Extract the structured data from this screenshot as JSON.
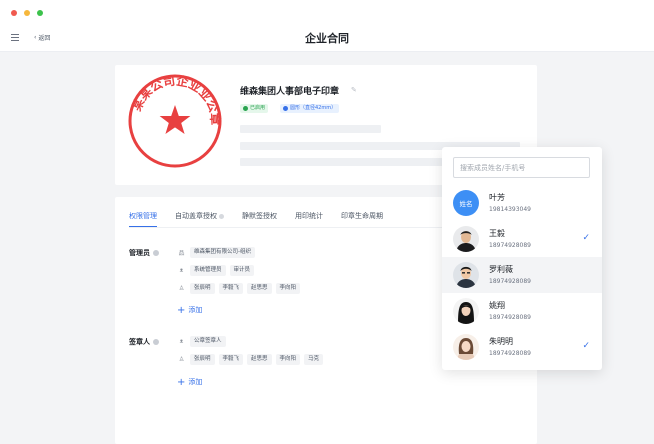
{
  "header": {
    "title": "企业合同",
    "back_label": "返回"
  },
  "seal": {
    "name": "维森集团人事部电子印章",
    "status_tag": "已启用",
    "spec_tag": "圆形（直径42mm）",
    "stamp_text": "某某公司企业业公章"
  },
  "tabs": [
    {
      "label": "权限管理"
    },
    {
      "label": "自动盖章授权"
    },
    {
      "label": "静默签授权"
    },
    {
      "label": "用印统计"
    },
    {
      "label": "印章生命周期"
    }
  ],
  "admins": {
    "label": "管理员",
    "org_chips": [
      "维森集团有限公司-组织"
    ],
    "role_chips": [
      "系统管理员",
      "审计员"
    ],
    "user_chips": [
      "张辰明",
      "李毅飞",
      "赵思思",
      "李向阳"
    ],
    "add_label": "添加"
  },
  "signers": {
    "label": "签章人",
    "role_chips": [
      "公章签章人"
    ],
    "user_chips": [
      "张辰明",
      "李毅飞",
      "赵思思",
      "李向阳",
      "马克"
    ],
    "add_label": "添加"
  },
  "picker": {
    "search_placeholder": "搜索成员姓名/手机号",
    "members": [
      {
        "name": "叶芳",
        "phone": "19814393049",
        "avatar_text": "姓名",
        "selected": false
      },
      {
        "name": "王毅",
        "phone": "18974928089",
        "selected": true
      },
      {
        "name": "罗利薇",
        "phone": "18974928089",
        "selected": false
      },
      {
        "name": "姚翔",
        "phone": "18974928089",
        "selected": false
      },
      {
        "name": "朱明明",
        "phone": "18974928089",
        "selected": true
      }
    ],
    "check_mark": "✓"
  },
  "colors": {
    "accent": "#3670e8",
    "seal_red": "#e84040",
    "enabled_green": "#29a34f"
  }
}
